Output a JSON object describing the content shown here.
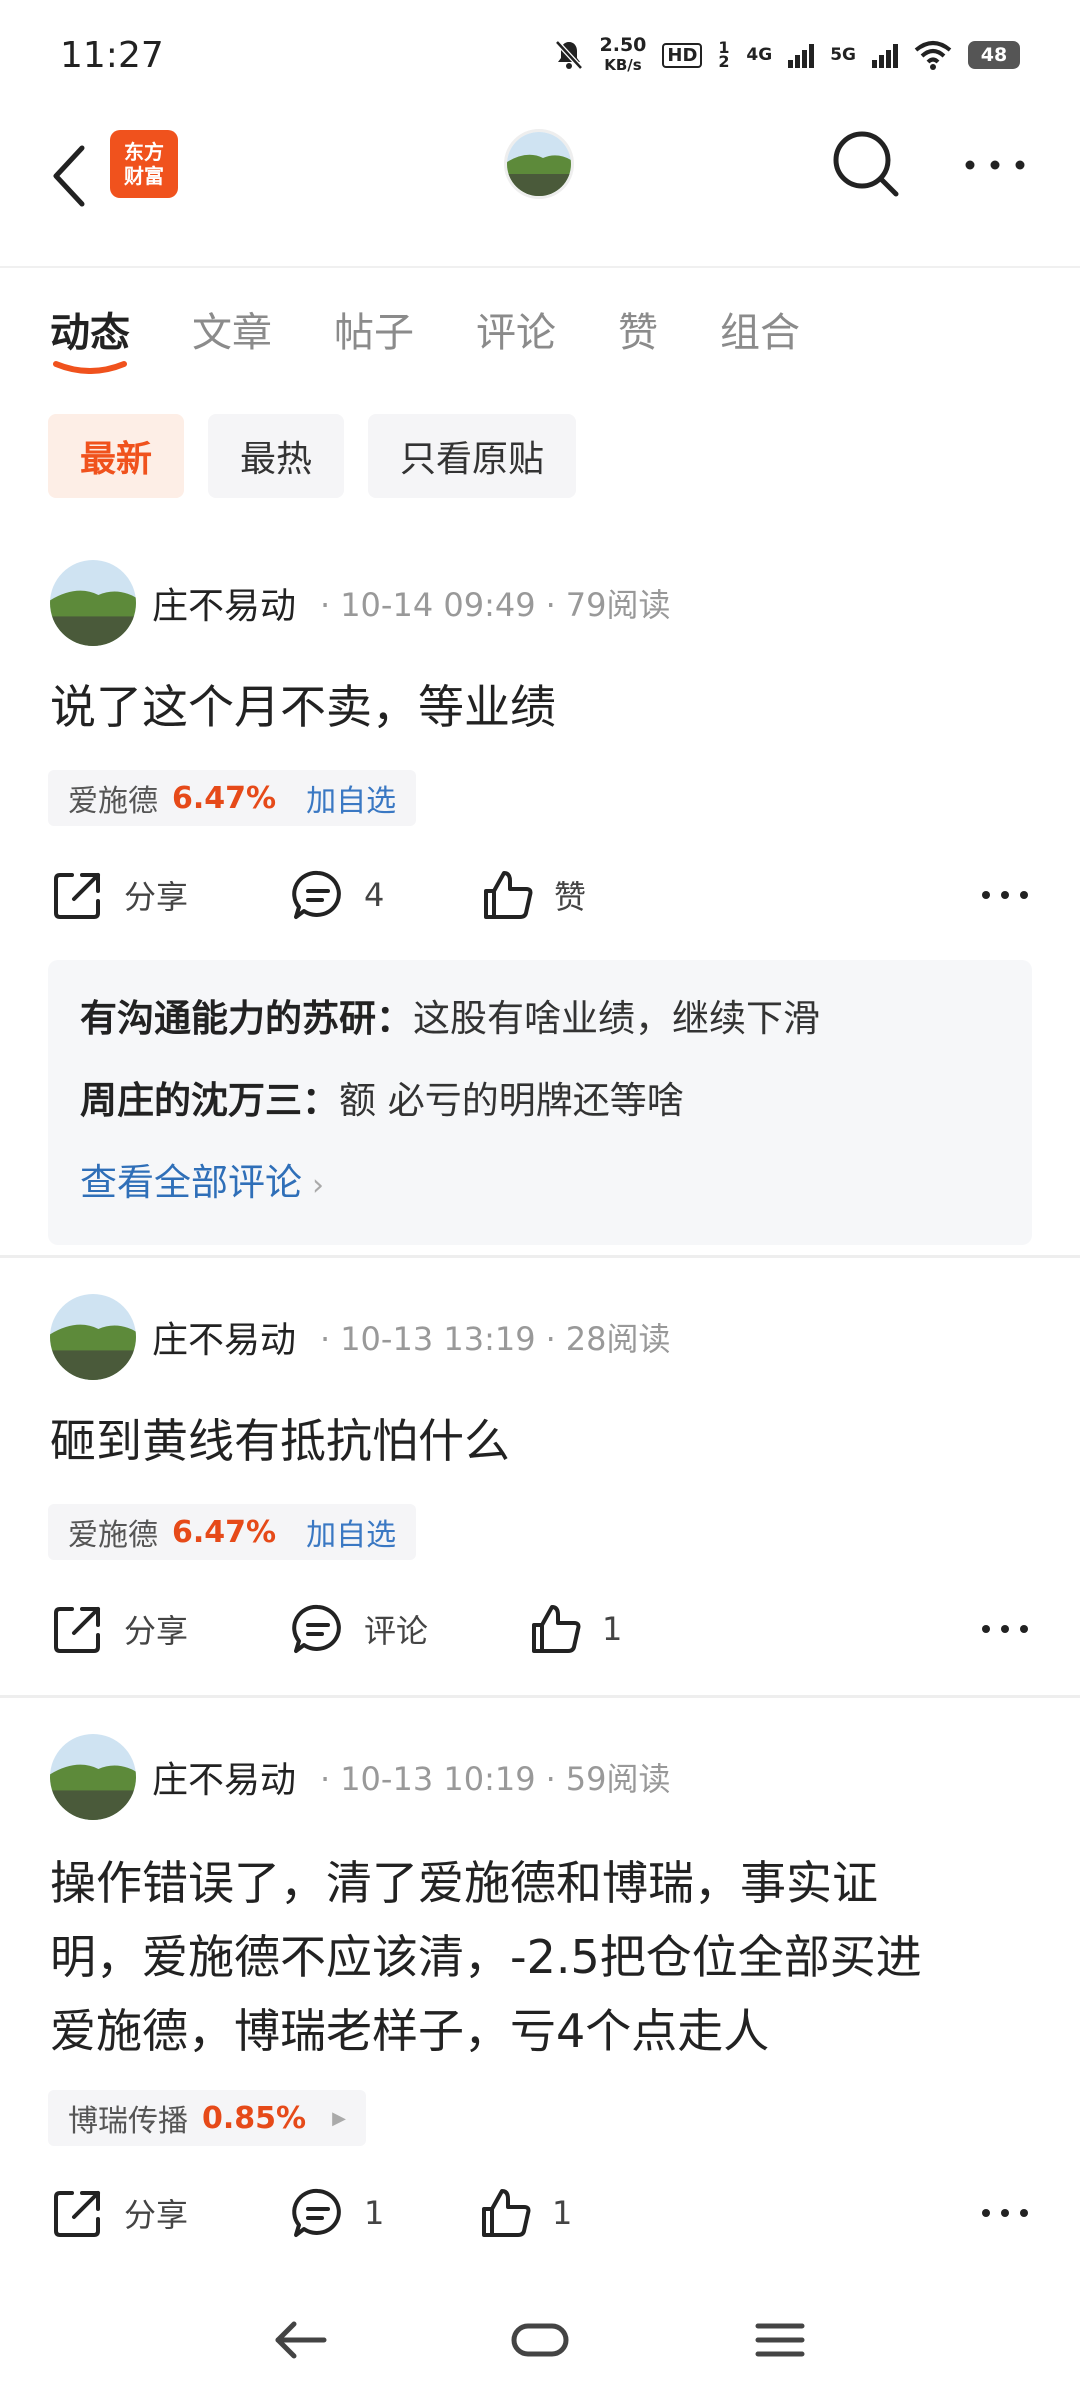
{
  "status_bar": {
    "time": "11:27",
    "net_speed_value": "2.50",
    "net_speed_unit": "KB/s",
    "hd_badge": "HD",
    "hd_sub": "1 2",
    "sig1": "4G",
    "sig2": "5G",
    "battery": "48"
  },
  "header": {
    "logo_line1": "东方",
    "logo_line2": "财富"
  },
  "tabs": [
    "动态",
    "文章",
    "帖子",
    "评论",
    "赞",
    "组合"
  ],
  "filters": [
    "最新",
    "最热",
    "只看原贴"
  ],
  "posts": [
    {
      "author": "庄不易动",
      "time": "10-14 09:49",
      "reads": "79阅读",
      "text": "说了这个月不卖，等业绩",
      "stock": {
        "name": "爱施德",
        "pct": "6.47%",
        "action": "加自选"
      },
      "share": "分享",
      "comments": "4",
      "likes": "赞",
      "comment_list": [
        {
          "user": "有沟通能力的苏研：",
          "text": "这股有啥业绩，继续下滑"
        },
        {
          "user": "周庄的沈万三：",
          "text": "额 必亏的明牌还等啥"
        }
      ],
      "view_all": "查看全部评论"
    },
    {
      "author": "庄不易动",
      "time": "10-13 13:19",
      "reads": "28阅读",
      "text": "砸到黄线有抵抗怕什么",
      "stock": {
        "name": "爱施德",
        "pct": "6.47%",
        "action": "加自选"
      },
      "share": "分享",
      "comments": "评论",
      "likes": "1"
    },
    {
      "author": "庄不易动",
      "time": "10-13 10:19",
      "reads": "59阅读",
      "text_lines": [
        "操作错误了，清了爱施德和博瑞，事实证",
        "明，爱施德不应该清，-2.5把仓位全部买进",
        "爱施德，博瑞老样子，亏4个点走人"
      ],
      "stock": {
        "name": "博瑞传播",
        "pct": "0.85%"
      },
      "share": "分享",
      "comments": "1",
      "likes": "1"
    }
  ],
  "colors": {
    "accent": "#f0521d",
    "link": "#2f6fb8",
    "up": "#e64a19"
  }
}
